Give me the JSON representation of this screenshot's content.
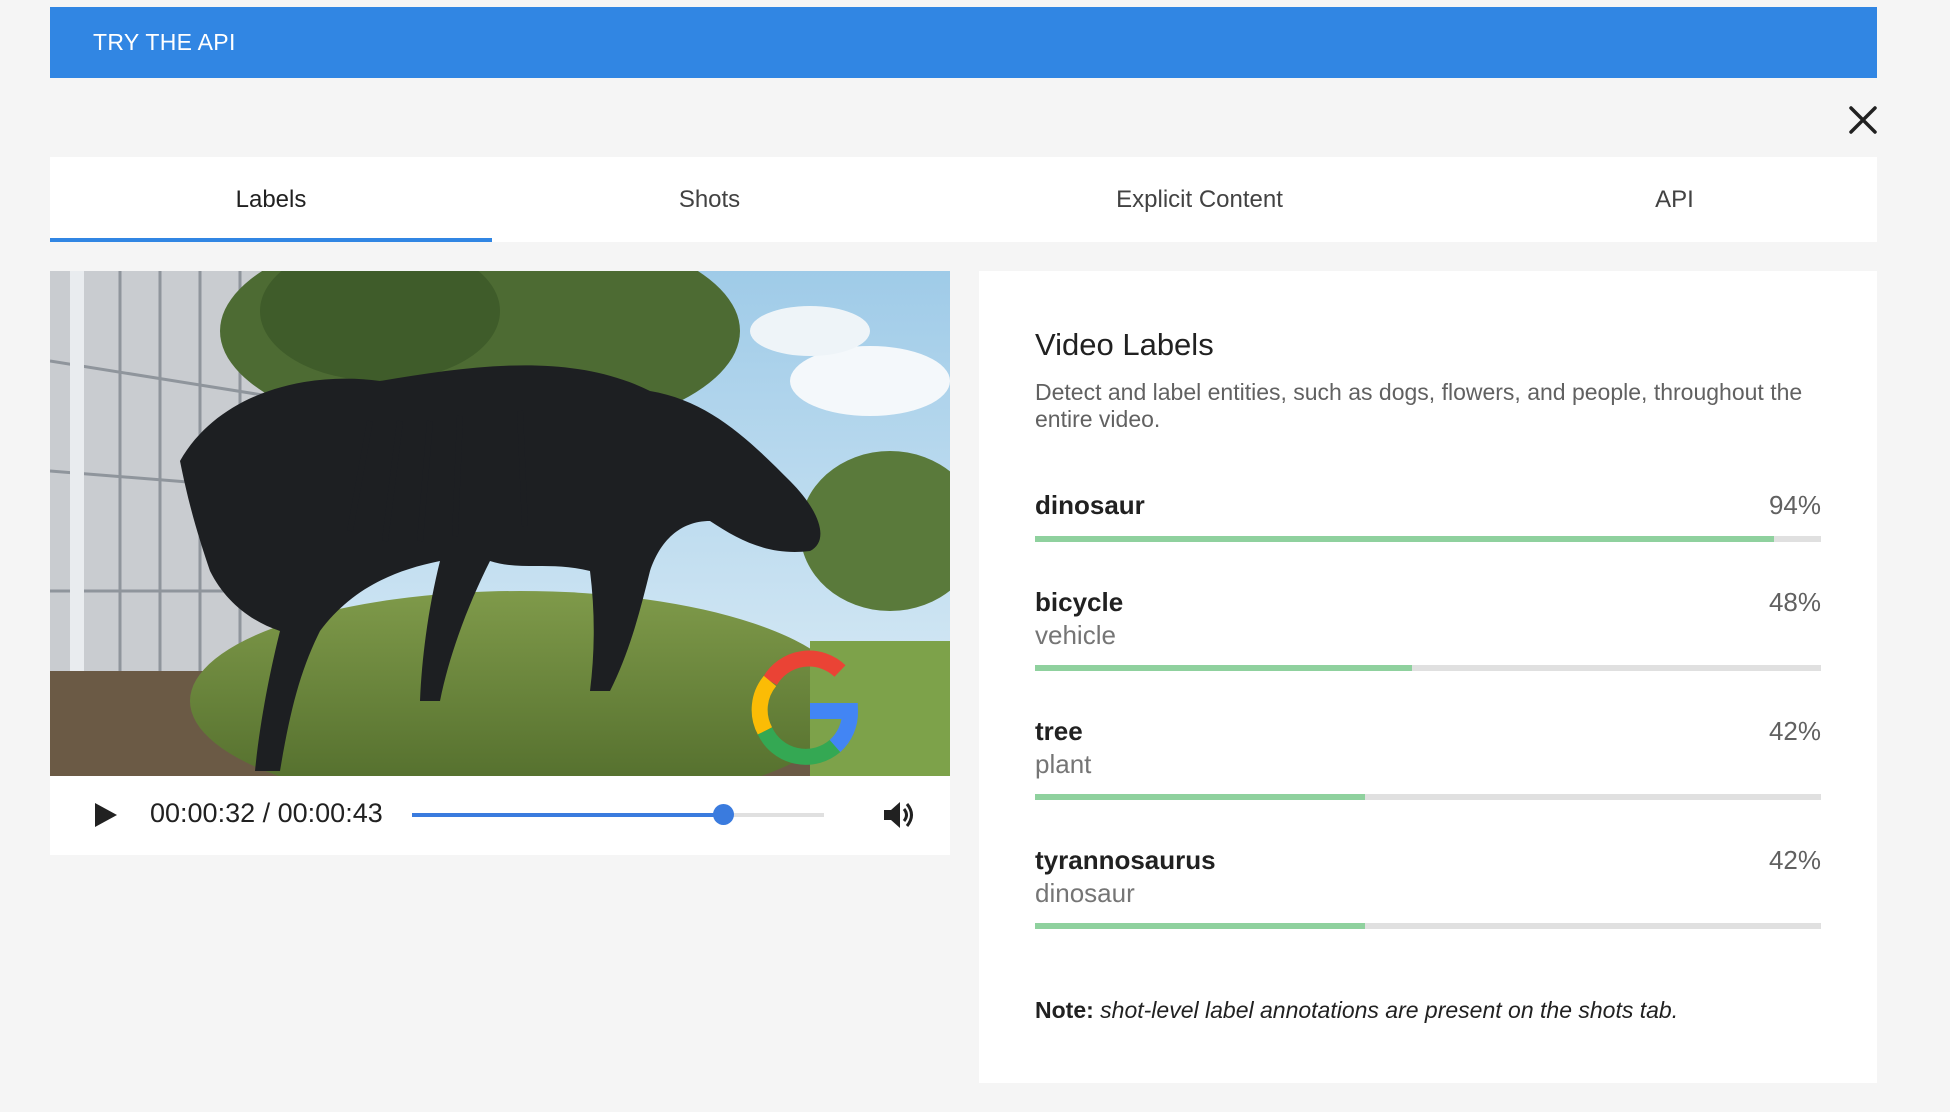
{
  "header": {
    "title": "TRY THE API"
  },
  "tabs": [
    {
      "label": "Labels",
      "active": true
    },
    {
      "label": "Shots",
      "active": false
    },
    {
      "label": "Explicit Content",
      "active": false
    },
    {
      "label": "API",
      "active": false
    }
  ],
  "player": {
    "current_time": "00:00:32",
    "separator": " / ",
    "duration": "00:00:43",
    "progress_fraction": 0.756
  },
  "panel": {
    "title": "Video Labels",
    "description": "Detect and label entities, such as dogs, flowers, and people, throughout the entire video.",
    "labels": [
      {
        "name": "dinosaur",
        "category": "",
        "percent": "94%",
        "value": 0.94
      },
      {
        "name": "bicycle",
        "category": "vehicle",
        "percent": "48%",
        "value": 0.48
      },
      {
        "name": "tree",
        "category": "plant",
        "percent": "42%",
        "value": 0.42
      },
      {
        "name": "tyrannosaurus",
        "category": "dinosaur",
        "percent": "42%",
        "value": 0.42
      }
    ],
    "note_prefix": "Note:",
    "note_text": " shot-level label annotations are present on the shots tab."
  },
  "colors": {
    "accent": "#3186e3",
    "confidence_bar": "#8fd19e",
    "seek": "#3a7bde"
  },
  "icons": {
    "close": "close-icon",
    "play": "play-icon",
    "volume": "volume-icon"
  }
}
